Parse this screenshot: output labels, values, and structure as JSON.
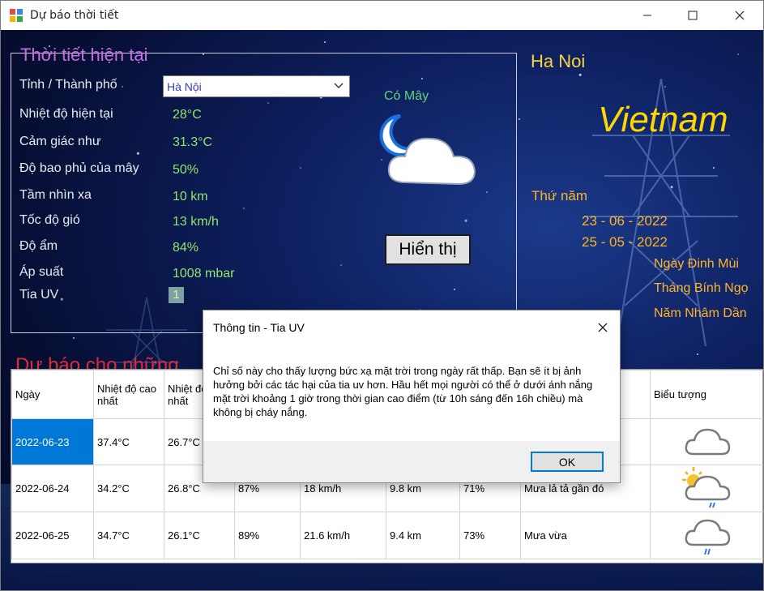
{
  "window": {
    "title": "Dự báo thời tiết"
  },
  "current": {
    "group_title": "Thời tiết hiện tại",
    "province_label": "Tỉnh / Thành phố",
    "province_value": "Hà Nội",
    "rows": [
      {
        "label": "Nhiệt độ hiện tại",
        "value": "28°C"
      },
      {
        "label": "Cảm giác như",
        "value": "31.3°C"
      },
      {
        "label": "Độ bao phủ của mây",
        "value": "50%"
      },
      {
        "label": "Tầm nhìn xa",
        "value": "10 km"
      },
      {
        "label": "Tốc độ gió",
        "value": "13 km/h"
      },
      {
        "label": "Độ ẩm",
        "value": "84%"
      },
      {
        "label": "Áp suất",
        "value": "1008 mbar"
      }
    ],
    "uv_label": "Tia UV",
    "uv_value": "1",
    "condition": "Có Mây",
    "condition_icon": "moon-cloud-icon",
    "show_button": "Hiển thị"
  },
  "location": {
    "city": "Ha Noi",
    "country": "Vietnam",
    "weekday": "Thứ năm",
    "solar_date": "23 - 06 - 2022",
    "lunar_date": "25 - 05 - 2022",
    "lunar_day": "Ngày Đinh Mùi",
    "lunar_month": "Tháng Bính Ngọ",
    "lunar_year": "Năm Nhâm Dần"
  },
  "forecast": {
    "title": "Dự báo cho những",
    "headers": {
      "date": "Ngày",
      "max_temp": "Nhiệt độ cao nhất",
      "min_temp": "Nhiệt độ thấp nhất",
      "icon": "Biểu tượng"
    },
    "rows": [
      {
        "date": "2022-06-23",
        "max": "37.4°C",
        "min": "26.7°C",
        "humidity": "",
        "wind": "",
        "vis": "",
        "cloud": "",
        "desc": "",
        "icon": "cloud-icon"
      },
      {
        "date": "2022-06-24",
        "max": "34.2°C",
        "min": "26.8°C",
        "humidity": "87%",
        "wind": "18 km/h",
        "vis": "9.8 km",
        "cloud": "71%",
        "desc": "Mưa lả tả gần đó",
        "icon": "sun-rain-cloud-icon"
      },
      {
        "date": "2022-06-25",
        "max": "34.7°C",
        "min": "26.1°C",
        "humidity": "89%",
        "wind": "21.6 km/h",
        "vis": "9.4 km",
        "cloud": "73%",
        "desc": "Mưa vừa",
        "icon": "rain-cloud-icon"
      }
    ]
  },
  "dialog": {
    "title": "Thông tin - Tia UV",
    "message": "Chỉ số này cho thấy lượng bức xạ mặt trời trong ngày rất thấp. Bạn sẽ ít bị ảnh hưởng bởi các tác hại của tia uv hơn. Hầu hết mọi người có thể ở dưới ánh nắng mặt trời khoảng 1 giờ trong thời gian cao điểm (từ 10h sáng đến 16h chiều) mà không bị cháy nắng.",
    "ok": "OK"
  },
  "colors": {
    "group_title": "#c86fe0",
    "value_green": "#8ee86a",
    "city_yellow": "#ffd23c",
    "date_orange": "#ffb428",
    "forecast_red": "#e02a3a",
    "selection_blue": "#0078d7"
  }
}
